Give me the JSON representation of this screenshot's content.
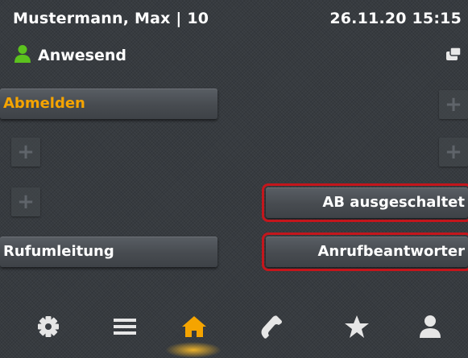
{
  "status": {
    "user": "Mustermann, Max | 10",
    "datetime": "26.11.20  15:15",
    "presence": "Anwesend",
    "presence_icon": "person-icon",
    "device_icon": "handset-icon"
  },
  "keys": {
    "logout": "Abmelden",
    "call_forwarding": "Rufumleitung",
    "answering_machine_status": "AB ausgeschaltet",
    "answering_machine": "Anrufbeantworter",
    "empty_key_symbol": "+"
  },
  "toolbar": {
    "items": [
      {
        "icon": "gear-icon"
      },
      {
        "icon": "menu-icon"
      },
      {
        "icon": "home-icon",
        "active": true
      },
      {
        "icon": "phone-icon"
      },
      {
        "icon": "star-icon"
      },
      {
        "icon": "contacts-icon"
      }
    ]
  },
  "colors": {
    "accent": "#f5a400",
    "highlight": "#c4161c",
    "presence": "#5cc21e",
    "background": "#3b3f44"
  }
}
